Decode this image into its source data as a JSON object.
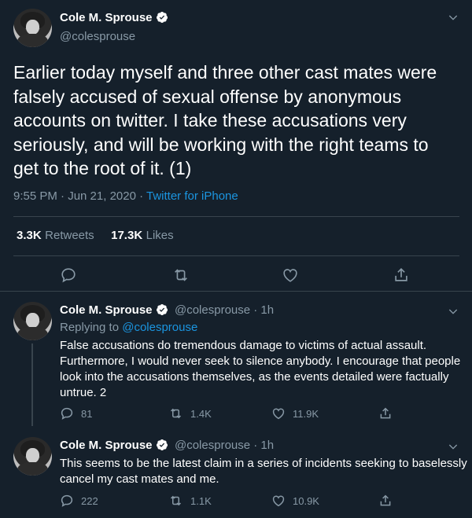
{
  "main_tweet": {
    "name": "Cole M. Sprouse",
    "handle": "@colesprouse",
    "text_lines": [
      "Earlier today myself and three other cast mates were",
      "falsely accused of sexual offense by anonymous",
      "accounts on twitter. I take these accusations very",
      "seriously, and will be working with the right teams to",
      "get to the root of it. (1)"
    ],
    "timestamp": "9:55 PM · Jun 21, 2020 · ",
    "source": "Twitter for iPhone",
    "retweets_count": "3.3K",
    "retweets_label": "Retweets",
    "likes_count": "17.3K",
    "likes_label": "Likes"
  },
  "replies": [
    {
      "name": "Cole M. Sprouse",
      "handle": "@colesprouse",
      "time": " · 1h",
      "replying_prefix": "Replying to ",
      "replying_to": "@colesprouse",
      "text_lines": [
        "False accusations do tremendous damage to victims of actual assault.",
        "Furthermore, I would never seek to silence anybody. I encourage that people",
        "look into the accusations themselves, as the events detailed were factually",
        "untrue. 2"
      ],
      "reply_count": "81",
      "retweet_count": "1.4K",
      "like_count": "11.9K"
    },
    {
      "name": "Cole M. Sprouse",
      "handle": "@colesprouse",
      "time": " · 1h",
      "text_lines": [
        "This seems to be the latest claim in a series of incidents seeking to baselessly",
        "cancel my cast mates and me."
      ],
      "reply_count": "222",
      "retweet_count": "1.1K",
      "like_count": "10.9K"
    }
  ],
  "icons": {
    "reply": "reply-icon",
    "retweet": "retweet-icon",
    "like": "heart-icon",
    "share": "share-icon",
    "more": "chevron-down-icon",
    "verified": "verified-badge-icon"
  },
  "colors": {
    "background": "#15202b",
    "accent": "#1b95e0",
    "muted": "#8899a6",
    "divider": "#38444d"
  }
}
